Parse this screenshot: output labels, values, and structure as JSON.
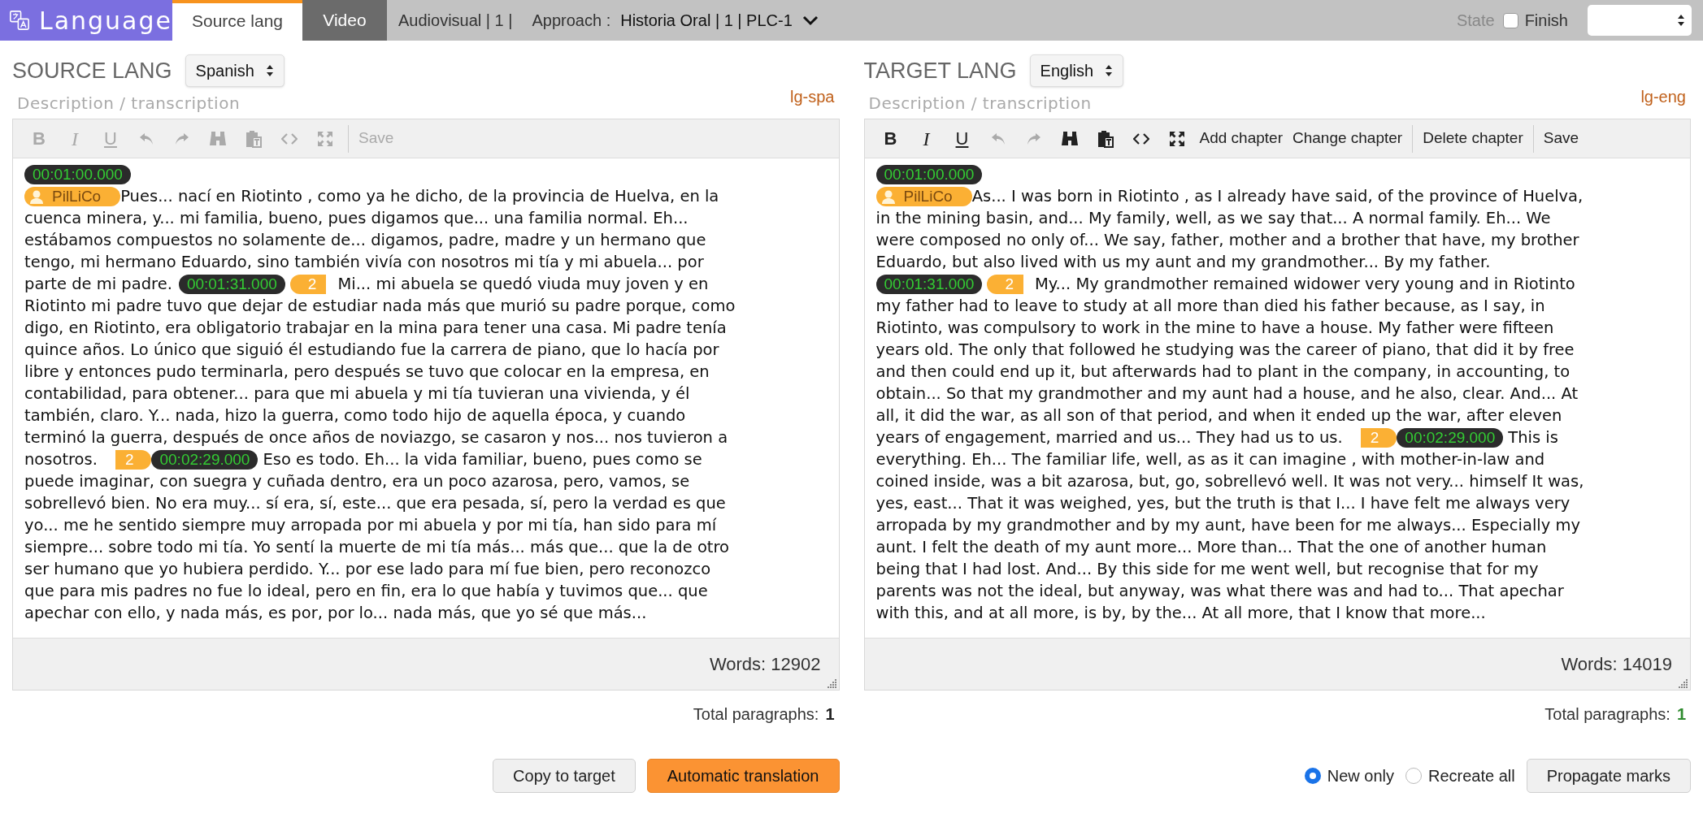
{
  "header": {
    "logo": "Language",
    "tabs": [
      {
        "label": "Source lang",
        "selected": true
      },
      {
        "label": "Video",
        "selected": false
      }
    ],
    "breadcrumb": "Audiovisual | 1 |",
    "approach_label": "Approach :",
    "approach_value": "Historia Oral | 1 | PLC-1",
    "state_label": "State",
    "finish": {
      "label": "Finish",
      "checked": false
    }
  },
  "panels": [
    {
      "title": "SOURCE LANG",
      "language": "Spanish",
      "field_label": "Description / transcription",
      "code": "lg-spa",
      "tools": [
        {
          "kind": "bold",
          "label": "B",
          "disabled": true
        },
        {
          "kind": "italic",
          "label": "I",
          "disabled": true
        },
        {
          "kind": "underline",
          "label": "U",
          "disabled": true
        },
        {
          "kind": "undo",
          "disabled": true
        },
        {
          "kind": "redo",
          "disabled": true
        },
        {
          "kind": "find",
          "disabled": true
        },
        {
          "kind": "paste",
          "disabled": true
        },
        {
          "kind": "code",
          "disabled": true
        },
        {
          "kind": "fullscreen",
          "disabled": true
        }
      ],
      "actions": [
        {
          "label": "Save",
          "disabled": true
        }
      ],
      "lines": [
        [
          {
            "kind": "time",
            "text": "00:01:00.000"
          }
        ],
        [
          {
            "kind": "speaker",
            "text": "PilLiCo"
          },
          {
            "kind": "text",
            "text": "Pues... nací en Riotinto , como ya he dicho, de la provincia de Huelva, en la"
          }
        ],
        [
          {
            "kind": "text",
            "text": "cuenca minera, y... mi familia, bueno, pues digamos que... una familia normal. Eh..."
          }
        ],
        [
          {
            "kind": "text",
            "text": "estábamos compuestos no solamente de... digamos, padre, madre y un hermano que"
          }
        ],
        [
          {
            "kind": "text",
            "text": "tengo, mi hermano Eduardo, sino también vivía con nosotros mi tía y mi abuela... por"
          }
        ],
        [
          {
            "kind": "text",
            "text": "parte de mi padre."
          },
          {
            "kind": "time",
            "text": "00:01:31.000"
          },
          {
            "kind": "mark_open",
            "text": "2"
          },
          {
            "kind": "text",
            "text": "Mi... mi abuela se quedó viuda muy joven y en"
          }
        ],
        [
          {
            "kind": "text",
            "text": "Riotinto mi padre tuvo que dejar de estudiar nada más que murió su padre porque, como"
          }
        ],
        [
          {
            "kind": "text",
            "text": "digo, en Riotinto, era obligatorio trabajar en la mina para tener una casa. Mi padre tenía"
          }
        ],
        [
          {
            "kind": "text",
            "text": "quince años. Lo único que siguió él estudiando fue la carrera de piano, que lo hacía por"
          }
        ],
        [
          {
            "kind": "text",
            "text": "libre y entonces pudo terminarla, pero después se tuvo que colocar en la empresa, en"
          }
        ],
        [
          {
            "kind": "text",
            "text": "contabilidad, para obtener... para que mi abuela y mi tía tuvieran una vivienda, y él"
          }
        ],
        [
          {
            "kind": "text",
            "text": "también, claro. Y... nada, hizo la guerra, como todo hijo de aquella época, y cuando"
          }
        ],
        [
          {
            "kind": "text",
            "text": "terminó la guerra, después de once años de noviazgo, se casaron y nos... nos tuvieron a"
          }
        ],
        [
          {
            "kind": "text",
            "text": "nosotros."
          },
          {
            "kind": "mark_close",
            "text": "2"
          },
          {
            "kind": "time",
            "text": "00:02:29.000"
          },
          {
            "kind": "text",
            "text": "Eso es todo. Eh... la vida familiar, bueno, pues como se"
          }
        ],
        [
          {
            "kind": "text",
            "text": "puede imaginar, con suegra y cuñada dentro, era un poco azarosa, pero, vamos, se"
          }
        ],
        [
          {
            "kind": "text",
            "text": "sobrellevó bien. No era muy... sí era, sí, este... que era pesada, sí, pero la verdad es que"
          }
        ],
        [
          {
            "kind": "text",
            "text": "yo... me he sentido siempre muy arropada por mi abuela y por mi tía, han sido para mí"
          }
        ],
        [
          {
            "kind": "text",
            "text": "siempre... sobre todo mi tía. Yo sentí la muerte de mi tía más... más que... que la de otro"
          }
        ],
        [
          {
            "kind": "text",
            "text": "ser humano que yo hubiera perdido. Y... por ese lado para mí fue bien, pero reconozco"
          }
        ],
        [
          {
            "kind": "text",
            "text": "que para mis padres no fue lo ideal, pero en fin, era lo que había y tuvimos que... que"
          }
        ],
        [
          {
            "kind": "text",
            "text": "apechar con ello, y nada más, es por, por lo... nada más, que yo sé que más..."
          }
        ]
      ],
      "words": "Words: 12902",
      "paragraphs_label": "Total paragraphs:",
      "paragraphs": "1",
      "paragraphs_ok": false,
      "controls": [
        {
          "kind": "button",
          "label": "Copy to target"
        },
        {
          "kind": "primary",
          "label": "Automatic translation"
        }
      ]
    },
    {
      "title": "TARGET LANG",
      "language": "English",
      "field_label": "Description / transcription",
      "code": "lg-eng",
      "tools": [
        {
          "kind": "bold",
          "label": "B",
          "disabled": false
        },
        {
          "kind": "italic",
          "label": "I",
          "disabled": false
        },
        {
          "kind": "underline",
          "label": "U",
          "disabled": false
        },
        {
          "kind": "undo",
          "disabled": true
        },
        {
          "kind": "redo",
          "disabled": true
        },
        {
          "kind": "find",
          "disabled": false
        },
        {
          "kind": "paste",
          "disabled": false
        },
        {
          "kind": "code",
          "disabled": false
        },
        {
          "kind": "fullscreen",
          "disabled": false
        }
      ],
      "actions": [
        {
          "label": "Add chapter",
          "disabled": false
        },
        {
          "label": "Change chapter",
          "disabled": false
        },
        {
          "label": "Delete chapter",
          "disabled": false
        },
        {
          "label": "Save",
          "disabled": false
        }
      ],
      "lines": [
        [
          {
            "kind": "time",
            "text": "00:01:00.000"
          }
        ],
        [
          {
            "kind": "speaker",
            "text": "PilLiCo"
          },
          {
            "kind": "text",
            "text": "As... I was born in Riotinto , as I already have said, of the province of Huelva,"
          }
        ],
        [
          {
            "kind": "text",
            "text": "in the mining basin, and... My family, well, as we say that... A normal family. Eh... We"
          }
        ],
        [
          {
            "kind": "text",
            "text": "were composed no only of... We say, father, mother and a brother that have, my brother"
          }
        ],
        [
          {
            "kind": "text",
            "text": "Eduardo, but also lived with us my aunt and my grandmother... By my father."
          }
        ],
        [
          {
            "kind": "time",
            "text": "00:01:31.000"
          },
          {
            "kind": "mark_open",
            "text": "2"
          },
          {
            "kind": "text",
            "text": "My... My grandmother remained widower very young and in Riotinto"
          }
        ],
        [
          {
            "kind": "text",
            "text": "my father had to leave to study at all more than died his father because, as I say, in"
          }
        ],
        [
          {
            "kind": "text",
            "text": "Riotinto, was compulsory to work in the mine to have a house. My father were fifteen"
          }
        ],
        [
          {
            "kind": "text",
            "text": "years old. The only that followed he studying was the career of piano, that did it by free"
          }
        ],
        [
          {
            "kind": "text",
            "text": "and then could end up it, but afterwards had to plant in the company, in accounting, to"
          }
        ],
        [
          {
            "kind": "text",
            "text": "obtain... So that my grandmother and my aunt had a house, and he also, clear. And... At"
          }
        ],
        [
          {
            "kind": "text",
            "text": "all, it did the war, as all son of that period, and when it ended up the war, after eleven"
          }
        ],
        [
          {
            "kind": "text",
            "text": "years of engagement, married and us... They had us to us."
          },
          {
            "kind": "mark_close",
            "text": "2"
          },
          {
            "kind": "time",
            "text": "00:02:29.000"
          },
          {
            "kind": "text",
            "text": "This is"
          }
        ],
        [
          {
            "kind": "text",
            "text": "everything. Eh... The familiar life, well, as as it can imagine , with mother-in-law and"
          }
        ],
        [
          {
            "kind": "text",
            "text": "coined inside, was a bit azarosa, but, go, sobrellevó well. It was not very... himself It was,"
          }
        ],
        [
          {
            "kind": "text",
            "text": "yes, east... That it was weighed, yes, but the truth is that I... I have felt me always very"
          }
        ],
        [
          {
            "kind": "text",
            "text": "arropada by my grandmother and by my aunt, have been for me always... Especially my"
          }
        ],
        [
          {
            "kind": "text",
            "text": "aunt. I felt the death of my aunt more... More than... That the one of another human"
          }
        ],
        [
          {
            "kind": "text",
            "text": "being that I had lost. And... By this side for me went well, but recognise that for my"
          }
        ],
        [
          {
            "kind": "text",
            "text": "parents was not the ideal, but anyway, was what there was and had to... That apechar"
          }
        ],
        [
          {
            "kind": "text",
            "text": "with this, and at all more, is by, by the... At all more, that I know that more..."
          }
        ]
      ],
      "words": "Words: 14019",
      "paragraphs_label": "Total paragraphs:",
      "paragraphs": "1",
      "paragraphs_ok": true,
      "controls": [
        {
          "kind": "radio",
          "label": "New only",
          "selected": true
        },
        {
          "kind": "radio",
          "label": "Recreate all",
          "selected": false
        },
        {
          "kind": "button",
          "label": "Propagate marks"
        }
      ]
    }
  ]
}
